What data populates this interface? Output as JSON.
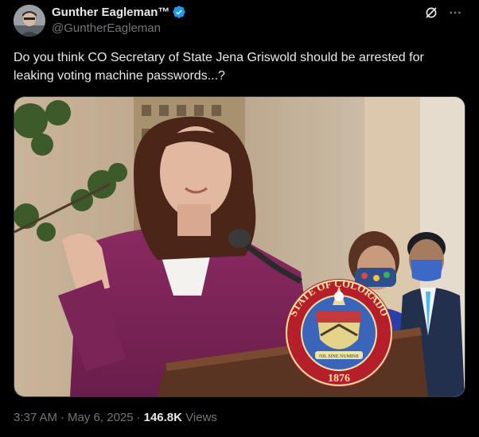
{
  "author": {
    "display_name": "Gunther Eagleman™",
    "handle": "@GuntherEagleman",
    "verified_color": "#1d9bf0"
  },
  "header_icons": [
    "grok-icon",
    "more-icon"
  ],
  "tweet": {
    "text": "Do you think CO Secretary of State Jena Griswold should be arrested for leaking voting machine passwords...?"
  },
  "media": {
    "seal_text_top": "STATE OF COLORADO",
    "seal_motto": "NIL SINE NUMINE",
    "seal_year": "1876"
  },
  "meta": {
    "time": "3:37 AM",
    "separator": "·",
    "date": "May 6, 2025",
    "views_count": "146.8K",
    "views_label": "Views"
  }
}
